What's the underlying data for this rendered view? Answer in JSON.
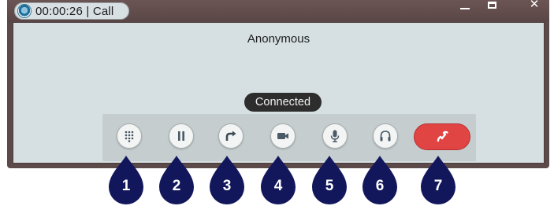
{
  "window": {
    "title": "00:00:26 | Call",
    "controls": {
      "minimize": "minimize",
      "maximize": "maximize",
      "close": "✕"
    }
  },
  "call": {
    "caller": "Anonymous",
    "status": "Connected"
  },
  "toolbar": {
    "buttons": [
      {
        "id": "dialpad",
        "icon": "dialpad-icon"
      },
      {
        "id": "hold",
        "icon": "pause-icon"
      },
      {
        "id": "transfer",
        "icon": "forward-arrow-icon"
      },
      {
        "id": "video",
        "icon": "video-camera-icon"
      },
      {
        "id": "mute",
        "icon": "microphone-icon"
      },
      {
        "id": "audio-device",
        "icon": "headset-icon"
      },
      {
        "id": "hangup",
        "icon": "phone-hangup-icon"
      }
    ]
  },
  "markers": [
    "1",
    "2",
    "3",
    "4",
    "5",
    "6",
    "7"
  ],
  "colors": {
    "window_frame": "#5c4a4a",
    "content_bg": "#d6e0e2",
    "toolbar_bg": "#c5cdcf",
    "hangup": "#e04443",
    "marker": "#12175c",
    "status_pill": "#2d2d2d"
  }
}
